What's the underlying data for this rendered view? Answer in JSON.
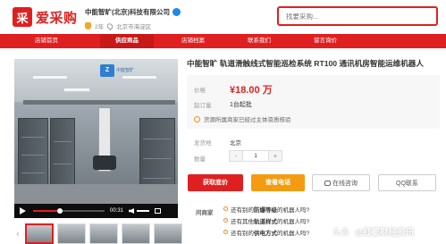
{
  "header": {
    "logo_mark": "采",
    "logo_text": "爱采购",
    "company_name": "中能智旷(北京)科技有限公司",
    "years": "2年",
    "location": "北京市海淀区",
    "search_placeholder": "找要采购..."
  },
  "nav": {
    "items": [
      {
        "label": "店铺首页",
        "active": false
      },
      {
        "label": "供应商品",
        "active": true
      },
      {
        "label": "店铺档案",
        "active": false
      },
      {
        "label": "联系我们",
        "active": false
      },
      {
        "label": "留言询价",
        "active": false
      }
    ]
  },
  "player": {
    "watermark_mark": "Z",
    "watermark_text": "中能智旷",
    "time": "00:31",
    "progress_fraction": 0.38,
    "volume_fraction": 0.6
  },
  "product": {
    "title": "中能智旷 轨道滑触线式智能巡检系统 RT100 通讯机房智能运维机器人",
    "price_label": "价格",
    "price": "¥18.00 万",
    "moq_label": "起订量",
    "moq": "1台起批",
    "notice": "货源所属商家已经过主体资质核验",
    "origin_label": "发货地",
    "origin": "北京",
    "qty_label": "数量",
    "qty": "1",
    "minus": "-",
    "plus": "+"
  },
  "actions": {
    "quote": "获取底价",
    "phone": "查看电话",
    "chat": "在线咨询",
    "qq": "QQ联系"
  },
  "qa": {
    "label": "问商家",
    "items": [
      {
        "prefix": "还有别的",
        "highlight": "防爆等级",
        "suffix": "的机器人吗?"
      },
      {
        "prefix": "还有其他",
        "highlight": "轨道样式",
        "suffix": "的机器人吗?"
      },
      {
        "prefix": "还有别的",
        "highlight": "供电方式",
        "suffix": "的机器人吗?"
      }
    ]
  },
  "watermark": {
    "platform": "头条",
    "account": "@红都财经资讯"
  },
  "colors": {
    "brand_red": "#e02020",
    "orange": "#f39c12"
  }
}
